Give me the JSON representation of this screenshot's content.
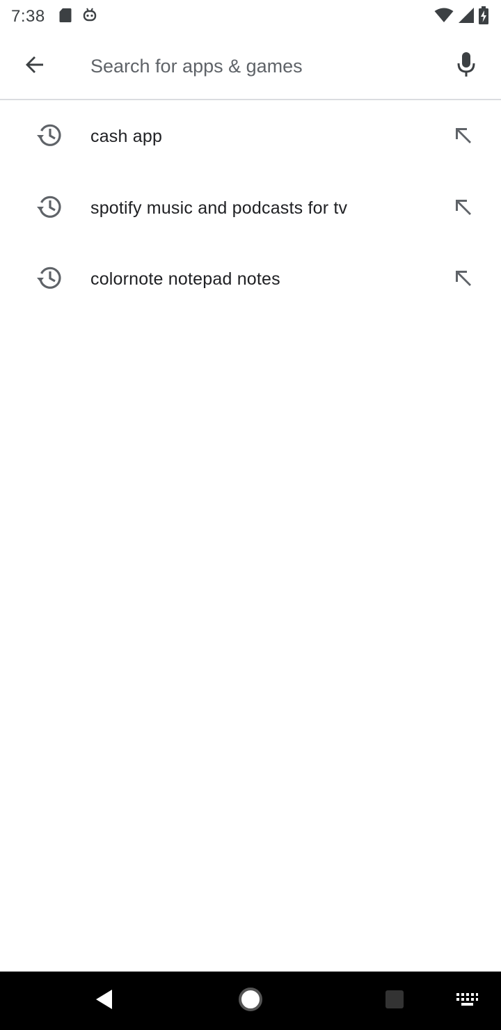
{
  "status_bar": {
    "time": "7:38",
    "left_icons": [
      "sd-card-icon",
      "assistant-icon"
    ],
    "right_icons": [
      "wifi-icon",
      "signal-icon",
      "battery-icon"
    ]
  },
  "search": {
    "placeholder": "Search for apps & games",
    "value": ""
  },
  "suggestions": [
    {
      "label": "cash app"
    },
    {
      "label": "spotify music and podcasts for tv"
    },
    {
      "label": "colornote notepad notes"
    }
  ],
  "colors": {
    "text_primary": "#202124",
    "text_secondary": "#5f6368",
    "divider": "#dadce0",
    "nav_bar": "#000000"
  }
}
